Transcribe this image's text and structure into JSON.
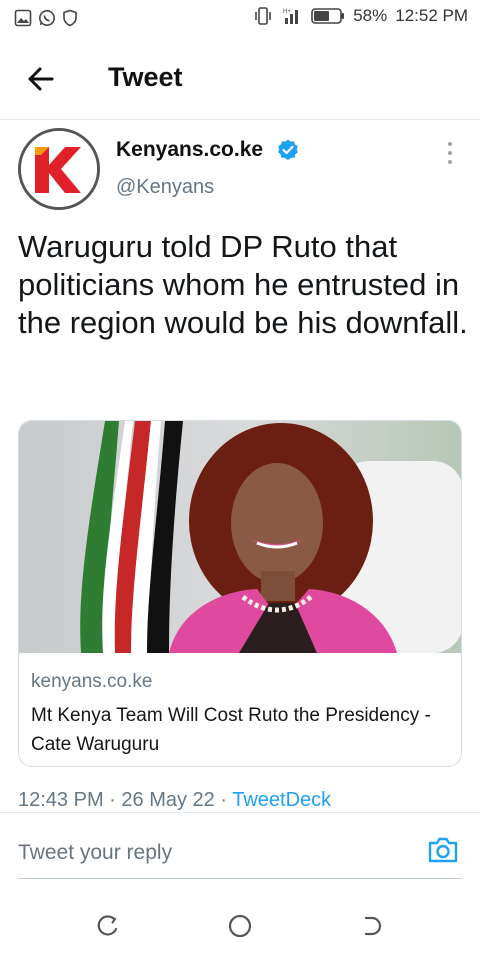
{
  "status_bar": {
    "battery": "58%",
    "time": "12:52 PM",
    "icons": [
      "image-icon",
      "whatsapp-icon",
      "shield-icon",
      "vibrate-icon",
      "signal-icon",
      "battery-icon"
    ]
  },
  "header": {
    "title": "Tweet",
    "back_icon": "arrow-left-icon"
  },
  "tweet": {
    "author_name": "Kenyans.co.ke",
    "author_handle": "@Kenyans",
    "verified": true,
    "text": "Waruguru told DP Ruto that politicians whom he entrusted in the region would be his downfall.",
    "card": {
      "domain": "kenyans.co.ke",
      "title": "Mt Kenya Team Will Cost Ruto the Presidency - Cate Waruguru"
    },
    "meta": {
      "time": "12:43 PM",
      "separator": "·",
      "date": "26 May 22",
      "source": "TweetDeck"
    }
  },
  "reply": {
    "placeholder": "Tweet your reply",
    "camera_icon": "camera-icon"
  },
  "colors": {
    "accent": "#1da1f2",
    "secondary_text": "#657786",
    "brand_red": "#e0202a"
  }
}
